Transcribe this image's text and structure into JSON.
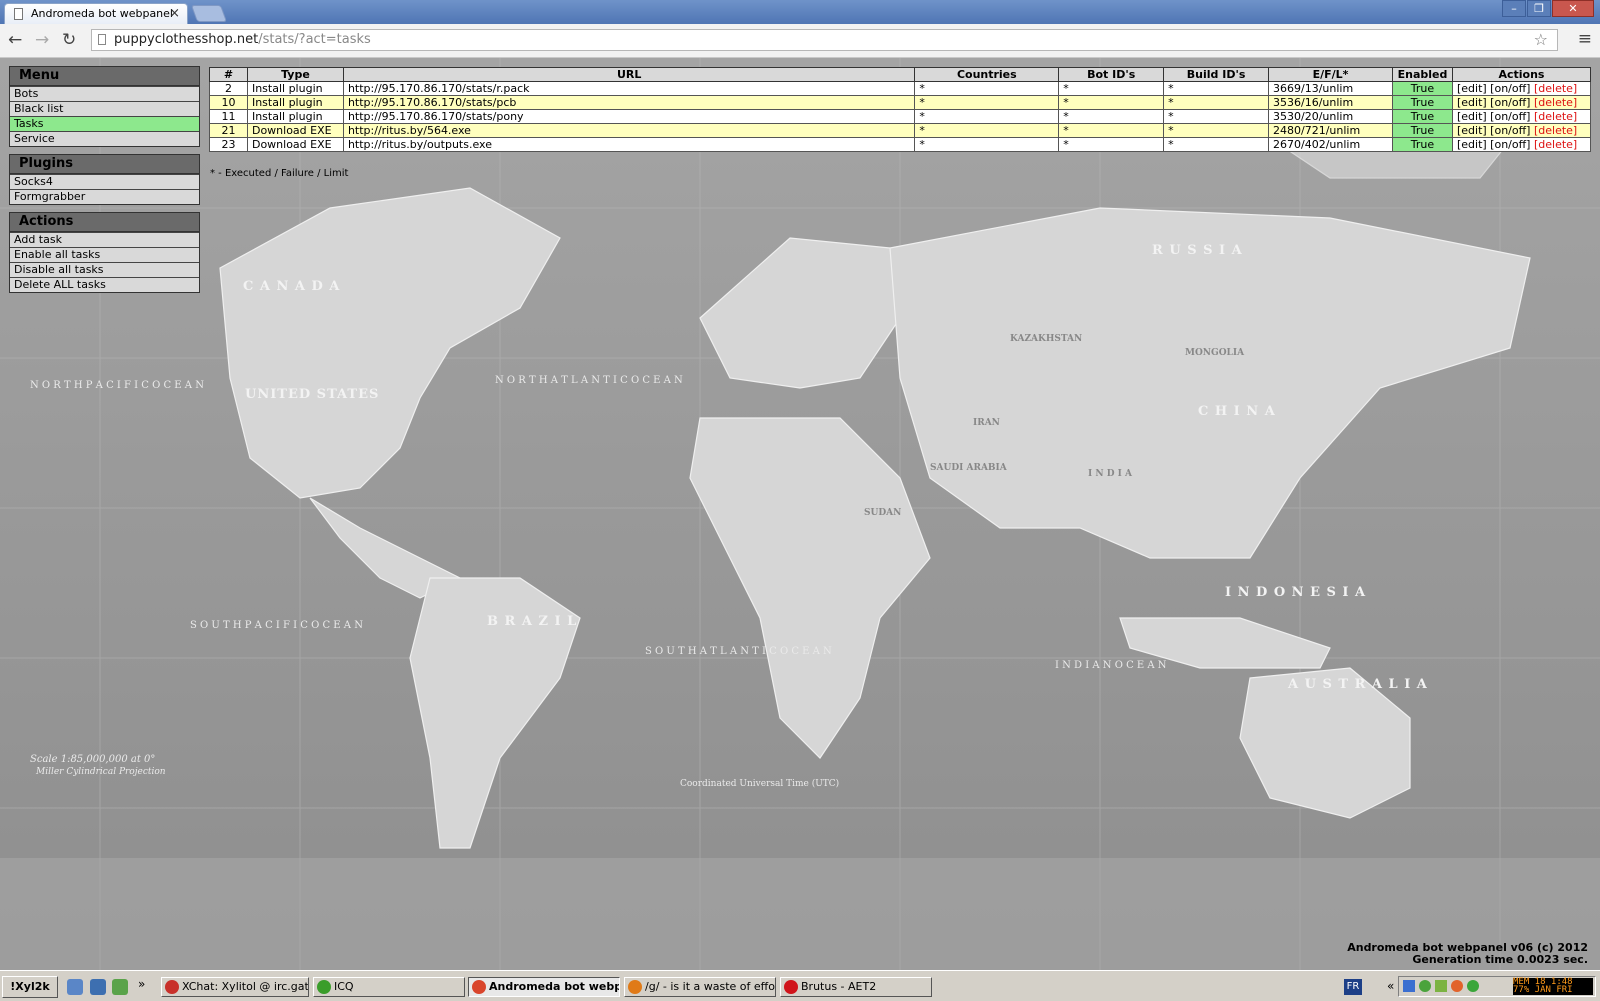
{
  "browser": {
    "tab_title": "Andromeda bot webpanel",
    "close_glyph": "×",
    "url_host": "puppyclothesshop.net",
    "url_path": "/stats/?act=tasks",
    "back_icon": "←",
    "forward_icon": "→",
    "reload_icon": "↻",
    "star_icon": "☆",
    "menu_icon": "≡",
    "win_min": "–",
    "win_max": "❐",
    "win_close": "✕"
  },
  "sidebar": {
    "menu": {
      "title": "Menu",
      "items": [
        {
          "label": "Bots"
        },
        {
          "label": "Black list"
        },
        {
          "label": "Tasks"
        },
        {
          "label": "Service"
        }
      ]
    },
    "plugins": {
      "title": "Plugins",
      "items": [
        {
          "label": "Socks4"
        },
        {
          "label": "Formgrabber"
        }
      ]
    },
    "actions": {
      "title": "Actions",
      "items": [
        {
          "label": "Add task"
        },
        {
          "label": "Enable all tasks"
        },
        {
          "label": "Disable all tasks"
        },
        {
          "label": "Delete ALL tasks"
        }
      ]
    }
  },
  "table": {
    "headers": [
      "#",
      "Type",
      "URL",
      "Countries",
      "Bot ID's",
      "Build ID's",
      "E/F/L*",
      "Enabled",
      "Actions"
    ],
    "rows": [
      {
        "id": "2",
        "type": "Install plugin",
        "url": "http://95.170.86.170/stats/r.pack",
        "countries": "*",
        "bot_ids": "*",
        "build_ids": "*",
        "efl": "3669/13/unlim",
        "enabled": "True"
      },
      {
        "id": "10",
        "type": "Install plugin",
        "url": "http://95.170.86.170/stats/pcb",
        "countries": "*",
        "bot_ids": "*",
        "build_ids": "*",
        "efl": "3536/16/unlim",
        "enabled": "True"
      },
      {
        "id": "11",
        "type": "Install plugin",
        "url": "http://95.170.86.170/stats/pony",
        "countries": "*",
        "bot_ids": "*",
        "build_ids": "*",
        "efl": "3530/20/unlim",
        "enabled": "True"
      },
      {
        "id": "21",
        "type": "Download EXE",
        "url": "http://ritus.by/564.exe",
        "countries": "*",
        "bot_ids": "*",
        "build_ids": "*",
        "efl": "2480/721/unlim",
        "enabled": "True"
      },
      {
        "id": "23",
        "type": "Download EXE",
        "url": "http://ritus.by/outputs.exe",
        "countries": "*",
        "bot_ids": "*",
        "build_ids": "*",
        "efl": "2670/402/unlim",
        "enabled": "True"
      }
    ],
    "action_edit": "[edit]",
    "action_toggle": "[on/off]",
    "action_delete": "[delete]",
    "legend": "* - Executed / Failure / Limit"
  },
  "map_labels": {
    "canada": "C A N A D A",
    "united_states": "UNITED STATES",
    "russia": "R U S S I A",
    "china": "C H I N A",
    "brazil": "B R A Z I L",
    "australia": "A U S T R A L I A",
    "indonesia": "I N D O N E S I A",
    "mongolia": "MONGOLIA",
    "kazakhstan": "KAZAKHSTAN",
    "india": "I N D I A",
    "iran": "IRAN",
    "saudi_arabia": "SAUDI ARABIA",
    "sudan": "SUDAN",
    "north_pacific": "N O R T H  P A C I F I C  O C E A N",
    "north_atlantic": "N O R T H  A T L A N T I C  O C E A N",
    "south_pacific": "S O U T H  P A C I F I C  O C E A N",
    "south_atlantic": "S O U T H  A T L A N T I C  O C E A N",
    "indian_ocean": "I N D I A N  O C E A N",
    "scale": "Scale 1:85,000,000 at 0°",
    "projection": "Miller Cylindrical Projection",
    "utc": "Coordinated Universal Time (UTC)"
  },
  "footer": {
    "line1": "Andromeda bot webpanel v06 (c) 2012",
    "line2": "Generation time 0.0023 sec."
  },
  "taskbar": {
    "start_label": "!Xyl2k",
    "more": "»",
    "buttons": [
      {
        "label": "XChat: Xylitol @ irc.gate...",
        "color": "#c8302a"
      },
      {
        "label": "ICQ",
        "color": "#3a9d2a"
      },
      {
        "label": "Andromeda bot webp...",
        "color": "#d9452b"
      },
      {
        "label": "/g/ - is it a waste of effo...",
        "color": "#e07a17"
      },
      {
        "label": "Brutus - AET2",
        "color": "#d0141b"
      }
    ],
    "lang": "FR",
    "tray_chevron": "«",
    "clock_line1": "MEM 18 1:48",
    "clock_line2": "77% JAN FRI"
  }
}
